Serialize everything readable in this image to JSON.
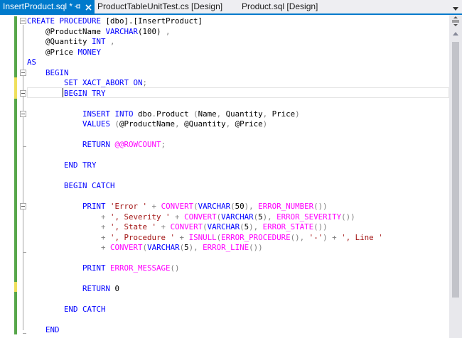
{
  "tabs": [
    {
      "label": "InsertProduct.sql *",
      "active": true
    },
    {
      "label": "ProductTableUnitTest.cs [Design]",
      "active": false
    },
    {
      "label": "Product.sql [Design]",
      "active": false
    }
  ],
  "tab_icons": {
    "pin": "pin-icon",
    "close": "close-icon",
    "overflow": "chevron-down-icon"
  },
  "colors": {
    "accent": "#007acc",
    "keyword": "#0000ff",
    "string": "#a31515",
    "function": "#ff00ff",
    "operator": "#808080",
    "changed_saved": "#57a64a",
    "changed_unsaved": "#efe05c"
  },
  "editor": {
    "language": "SQL",
    "lines": [
      [
        [
          "CREATE PROCEDURE ",
          "kw"
        ],
        [
          "[dbo].[InsertProduct]",
          "pl"
        ]
      ],
      [
        [
          "    @ProductName ",
          "pl"
        ],
        [
          "VARCHAR",
          "kw"
        ],
        [
          "(100) ",
          "pl"
        ],
        [
          ",",
          "gr"
        ]
      ],
      [
        [
          "    @Quantity ",
          "pl"
        ],
        [
          "INT",
          "kw"
        ],
        [
          " ",
          "pl"
        ],
        [
          ",",
          "gr"
        ]
      ],
      [
        [
          "    @Price ",
          "pl"
        ],
        [
          "MONEY",
          "kw"
        ]
      ],
      [
        [
          "AS",
          "kw"
        ]
      ],
      [
        [
          "    ",
          "pl"
        ],
        [
          "BEGIN",
          "kw"
        ]
      ],
      [
        [
          "        ",
          "pl"
        ],
        [
          "SET XACT_ABORT ON",
          "kw"
        ],
        [
          ";",
          "gr"
        ]
      ],
      [
        [
          "        ",
          "pl"
        ],
        [
          "BEGIN TRY",
          "kw"
        ]
      ],
      [
        [
          "",
          "pl"
        ]
      ],
      [
        [
          "            ",
          "pl"
        ],
        [
          "INSERT INTO ",
          "kw"
        ],
        [
          "dbo",
          "pl"
        ],
        [
          ".",
          "gr"
        ],
        [
          "Product ",
          "pl"
        ],
        [
          "(",
          "gr"
        ],
        [
          "Name",
          "pl"
        ],
        [
          ", ",
          "gr"
        ],
        [
          "Quantity",
          "pl"
        ],
        [
          ", ",
          "gr"
        ],
        [
          "Price",
          "pl"
        ],
        [
          ")",
          "gr"
        ]
      ],
      [
        [
          "            ",
          "pl"
        ],
        [
          "VALUES ",
          "kw"
        ],
        [
          "(",
          "gr"
        ],
        [
          "@ProductName",
          "pl"
        ],
        [
          ", ",
          "gr"
        ],
        [
          "@Quantity",
          "pl"
        ],
        [
          ", ",
          "gr"
        ],
        [
          "@Price",
          "pl"
        ],
        [
          ")",
          "gr"
        ]
      ],
      [
        [
          "",
          "pl"
        ]
      ],
      [
        [
          "            ",
          "pl"
        ],
        [
          "RETURN ",
          "kw"
        ],
        [
          "@@ROWCOUNT",
          "fn"
        ],
        [
          ";",
          "gr"
        ]
      ],
      [
        [
          "",
          "pl"
        ]
      ],
      [
        [
          "        ",
          "pl"
        ],
        [
          "END TRY",
          "kw"
        ]
      ],
      [
        [
          "",
          "pl"
        ]
      ],
      [
        [
          "        ",
          "pl"
        ],
        [
          "BEGIN CATCH",
          "kw"
        ]
      ],
      [
        [
          "",
          "pl"
        ]
      ],
      [
        [
          "            ",
          "pl"
        ],
        [
          "PRINT ",
          "kw"
        ],
        [
          "'Error '",
          "str"
        ],
        [
          " + ",
          "gr"
        ],
        [
          "CONVERT",
          "fn"
        ],
        [
          "(",
          "gr"
        ],
        [
          "VARCHAR",
          "kw"
        ],
        [
          "(",
          "gr"
        ],
        [
          "50",
          "pl"
        ],
        [
          "), ",
          "gr"
        ],
        [
          "ERROR_NUMBER",
          "fn"
        ],
        [
          "())",
          "gr"
        ]
      ],
      [
        [
          "                ",
          "pl"
        ],
        [
          "+ ",
          "gr"
        ],
        [
          "', Severity '",
          "str"
        ],
        [
          " + ",
          "gr"
        ],
        [
          "CONVERT",
          "fn"
        ],
        [
          "(",
          "gr"
        ],
        [
          "VARCHAR",
          "kw"
        ],
        [
          "(",
          "gr"
        ],
        [
          "5",
          "pl"
        ],
        [
          "), ",
          "gr"
        ],
        [
          "ERROR_SEVERITY",
          "fn"
        ],
        [
          "())",
          "gr"
        ]
      ],
      [
        [
          "                ",
          "pl"
        ],
        [
          "+ ",
          "gr"
        ],
        [
          "', State '",
          "str"
        ],
        [
          " + ",
          "gr"
        ],
        [
          "CONVERT",
          "fn"
        ],
        [
          "(",
          "gr"
        ],
        [
          "VARCHAR",
          "kw"
        ],
        [
          "(",
          "gr"
        ],
        [
          "5",
          "pl"
        ],
        [
          "), ",
          "gr"
        ],
        [
          "ERROR_STATE",
          "fn"
        ],
        [
          "())",
          "gr"
        ]
      ],
      [
        [
          "                ",
          "pl"
        ],
        [
          "+ ",
          "gr"
        ],
        [
          "', Procedure '",
          "str"
        ],
        [
          " + ",
          "gr"
        ],
        [
          "ISNULL",
          "fn"
        ],
        [
          "(",
          "gr"
        ],
        [
          "ERROR_PROCEDURE",
          "fn"
        ],
        [
          "(), ",
          "gr"
        ],
        [
          "'-'",
          "str"
        ],
        [
          ") + ",
          "gr"
        ],
        [
          "', Line '",
          "str"
        ]
      ],
      [
        [
          "                ",
          "pl"
        ],
        [
          "+ ",
          "gr"
        ],
        [
          "CONVERT",
          "fn"
        ],
        [
          "(",
          "gr"
        ],
        [
          "VARCHAR",
          "kw"
        ],
        [
          "(",
          "gr"
        ],
        [
          "5",
          "pl"
        ],
        [
          "), ",
          "gr"
        ],
        [
          "ERROR_LINE",
          "fn"
        ],
        [
          "())",
          "gr"
        ]
      ],
      [
        [
          "",
          "pl"
        ]
      ],
      [
        [
          "            ",
          "pl"
        ],
        [
          "PRINT ",
          "kw"
        ],
        [
          "ERROR_MESSAGE",
          "fn"
        ],
        [
          "()",
          "gr"
        ]
      ],
      [
        [
          "",
          "pl"
        ]
      ],
      [
        [
          "            ",
          "pl"
        ],
        [
          "RETURN ",
          "kw"
        ],
        [
          "0",
          "pl"
        ]
      ],
      [
        [
          "",
          "pl"
        ]
      ],
      [
        [
          "        ",
          "pl"
        ],
        [
          "END CATCH",
          "kw"
        ]
      ],
      [
        [
          "",
          "pl"
        ]
      ],
      [
        [
          "    ",
          "pl"
        ],
        [
          "END",
          "kw"
        ]
      ]
    ]
  }
}
